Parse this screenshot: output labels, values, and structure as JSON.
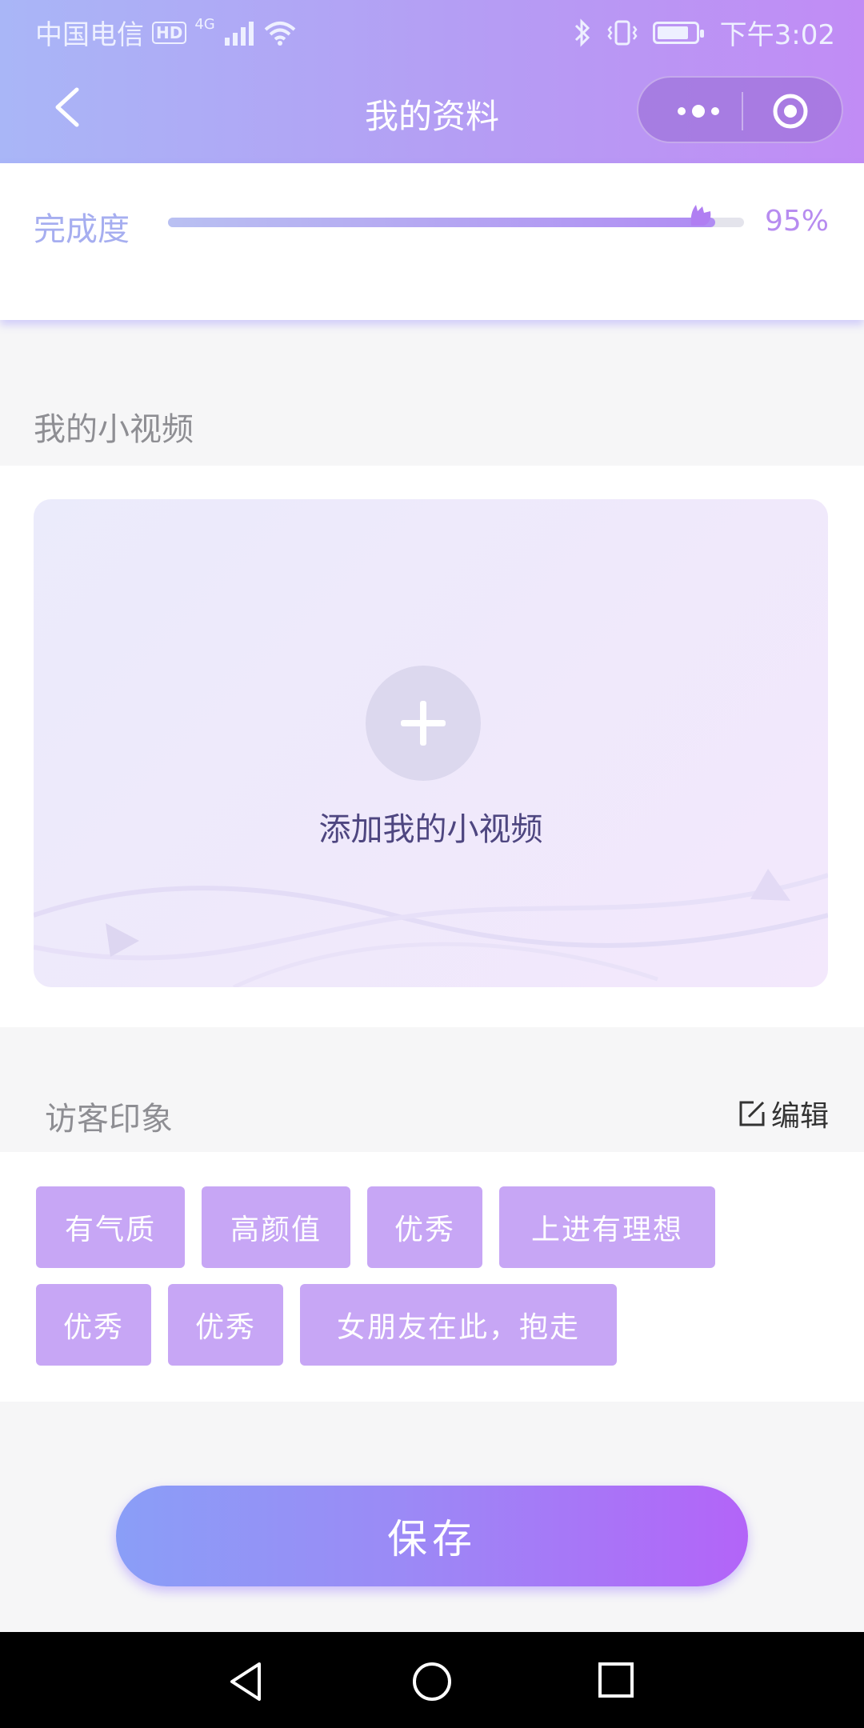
{
  "status_bar": {
    "carrier": "中国电信",
    "hd_badge": "HD",
    "network": "4G",
    "time": "下午3:02"
  },
  "header": {
    "title": "我的资料",
    "back_icon": "chevron-left-icon",
    "more_icon": "more-dots-icon",
    "close_icon": "target-circle-icon"
  },
  "completion": {
    "label": "完成度",
    "percent_text": "95%",
    "value": 0.95
  },
  "video_section": {
    "title": "我的小视频",
    "add_label": "添加我的小视频",
    "add_icon": "plus-icon"
  },
  "impressions": {
    "title": "访客印象",
    "edit_label": "编辑",
    "edit_icon": "edit-icon",
    "tags": [
      "有气质",
      "高颜值",
      "优秀",
      "上进有理想",
      "优秀",
      "优秀",
      "女朋友在此，抱走"
    ]
  },
  "actions": {
    "save_label": "保存"
  },
  "colors": {
    "accent": "#b78cf0",
    "tag_bg": "#c7a6f5",
    "header_start": "#a9b6f7",
    "header_end": "#c18cf5"
  },
  "navbar": {
    "icons": [
      "back-triangle-icon",
      "home-circle-icon",
      "recents-square-icon"
    ]
  }
}
